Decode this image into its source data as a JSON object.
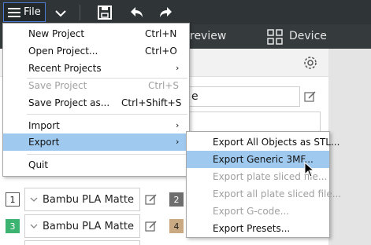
{
  "toolbar": {
    "file_label": "File",
    "icons": [
      "hamburger-icon",
      "chevron-down-icon",
      "save-icon",
      "undo-icon",
      "redo-icon"
    ]
  },
  "tabs": {
    "preview_label": "review",
    "device_label": "Device"
  },
  "panel": {
    "name_value": "e",
    "filaments": [
      {
        "num": "1",
        "label": "Bambu PLA Matte"
      },
      {
        "num": "3",
        "label": "Bambu PLA Matte"
      }
    ],
    "right_nums": [
      "2",
      "4"
    ]
  },
  "file_menu": {
    "items": [
      {
        "label": "New Project",
        "shortcut": "Ctrl+N"
      },
      {
        "label": "Open Project...",
        "shortcut": "Ctrl+O"
      },
      {
        "label": "Recent Projects"
      },
      {
        "label": "Save Project",
        "shortcut": "Ctrl+S"
      },
      {
        "label": "Save Project as...",
        "shortcut": "Ctrl+Shift+S"
      },
      {
        "label": "Import"
      },
      {
        "label": "Export"
      },
      {
        "label": "Quit"
      }
    ]
  },
  "export_menu": {
    "items": [
      {
        "label": "Export All Objects as STL..."
      },
      {
        "label": "Export Generic 3MF..."
      },
      {
        "label": "Export plate sliced file..."
      },
      {
        "label": "Export all plate sliced file..."
      },
      {
        "label": "Export G-code..."
      },
      {
        "label": "Export Presets..."
      }
    ]
  },
  "colors": {
    "topbar": "#2f3437",
    "highlight": "#9fc9ee",
    "accent_border": "#4c7bd3",
    "badge_green": "#3cb371",
    "badge_gray": "#6e6e6e",
    "badge_tan": "#c9a982"
  }
}
